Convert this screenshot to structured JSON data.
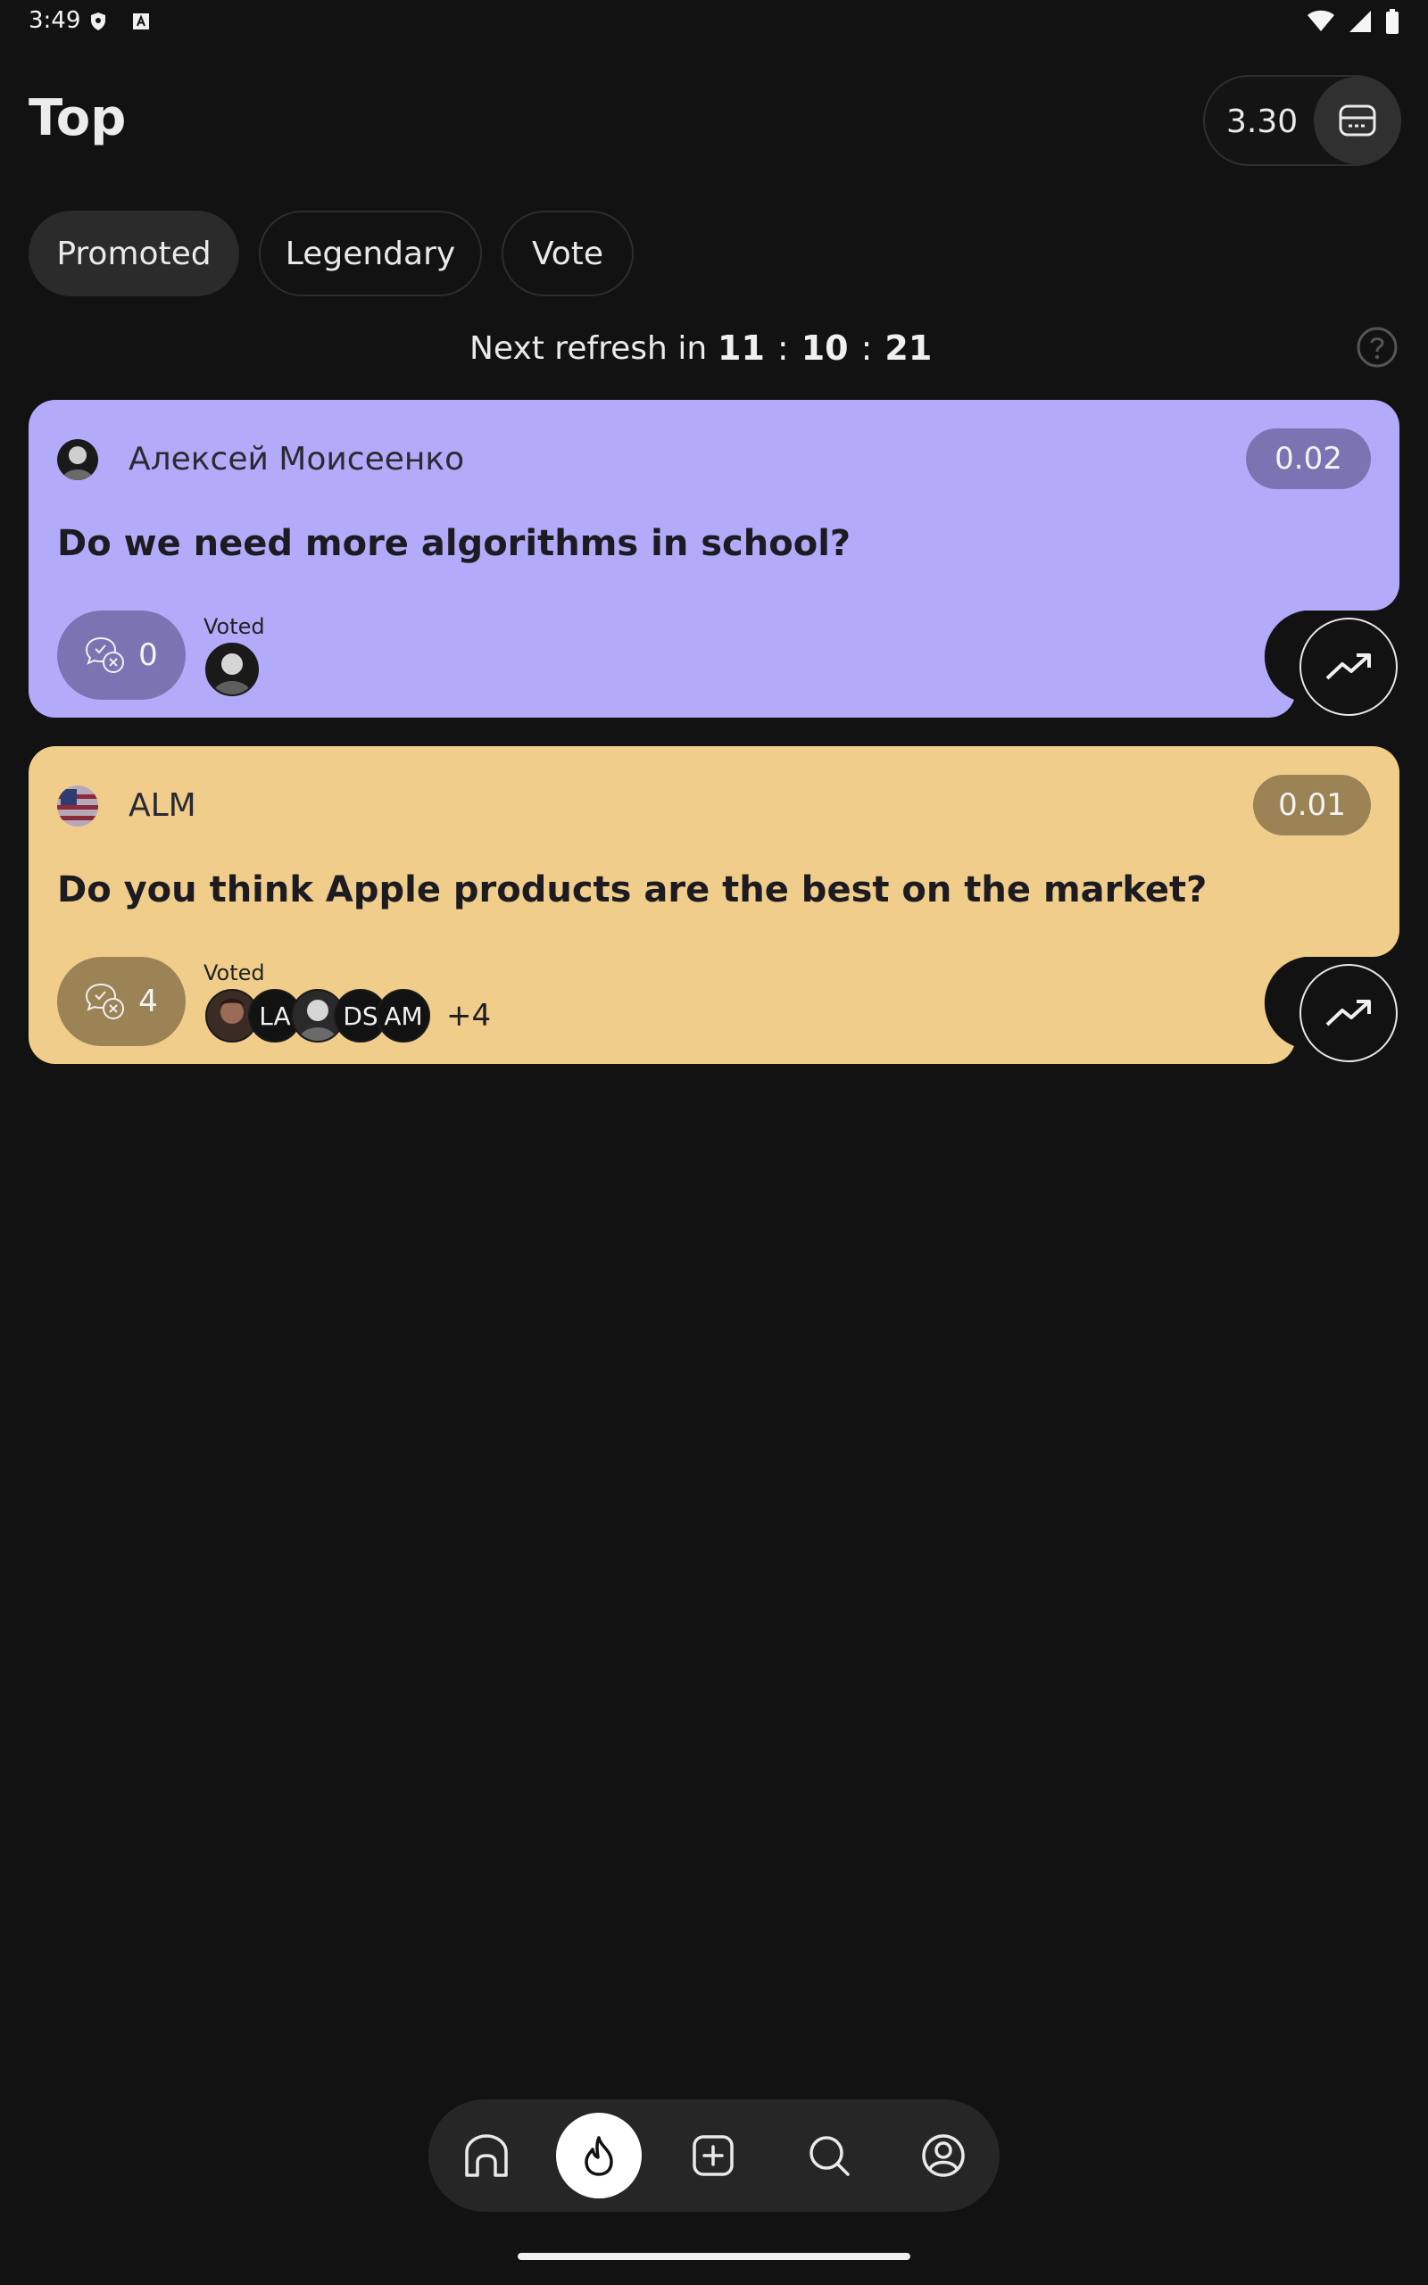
{
  "status_bar": {
    "time": "3:49"
  },
  "header": {
    "title": "Top",
    "balance": "3.30"
  },
  "tabs": [
    {
      "label": "Promoted",
      "active": true
    },
    {
      "label": "Legendary",
      "active": false
    },
    {
      "label": "Vote",
      "active": false
    }
  ],
  "refresh": {
    "label": "Next refresh in",
    "hours": "11",
    "minutes": "10",
    "seconds": "21",
    "separator": ":"
  },
  "cards": [
    {
      "author": "Алексей Моисеенко",
      "price": "0.02",
      "question": "Do we need more algorithms in school?",
      "votes": "0",
      "voted_label": "Voted",
      "voter_initials": [],
      "more": "",
      "bg_color": "#b2abfa",
      "accent_color": "#7b74b3"
    },
    {
      "author": "ALM",
      "price": "0.01",
      "question": "Do you think Apple products are the best on the market?",
      "votes": "4",
      "voted_label": "Voted",
      "voter_initials": [
        "LA",
        "DS",
        "AM"
      ],
      "more": "+4",
      "bg_color": "#f0cd8b",
      "accent_color": "#9b8356"
    }
  ],
  "nav": {
    "items": [
      "home-icon",
      "flame-icon",
      "add-icon",
      "search-icon",
      "profile-icon"
    ],
    "active": "flame-icon"
  }
}
